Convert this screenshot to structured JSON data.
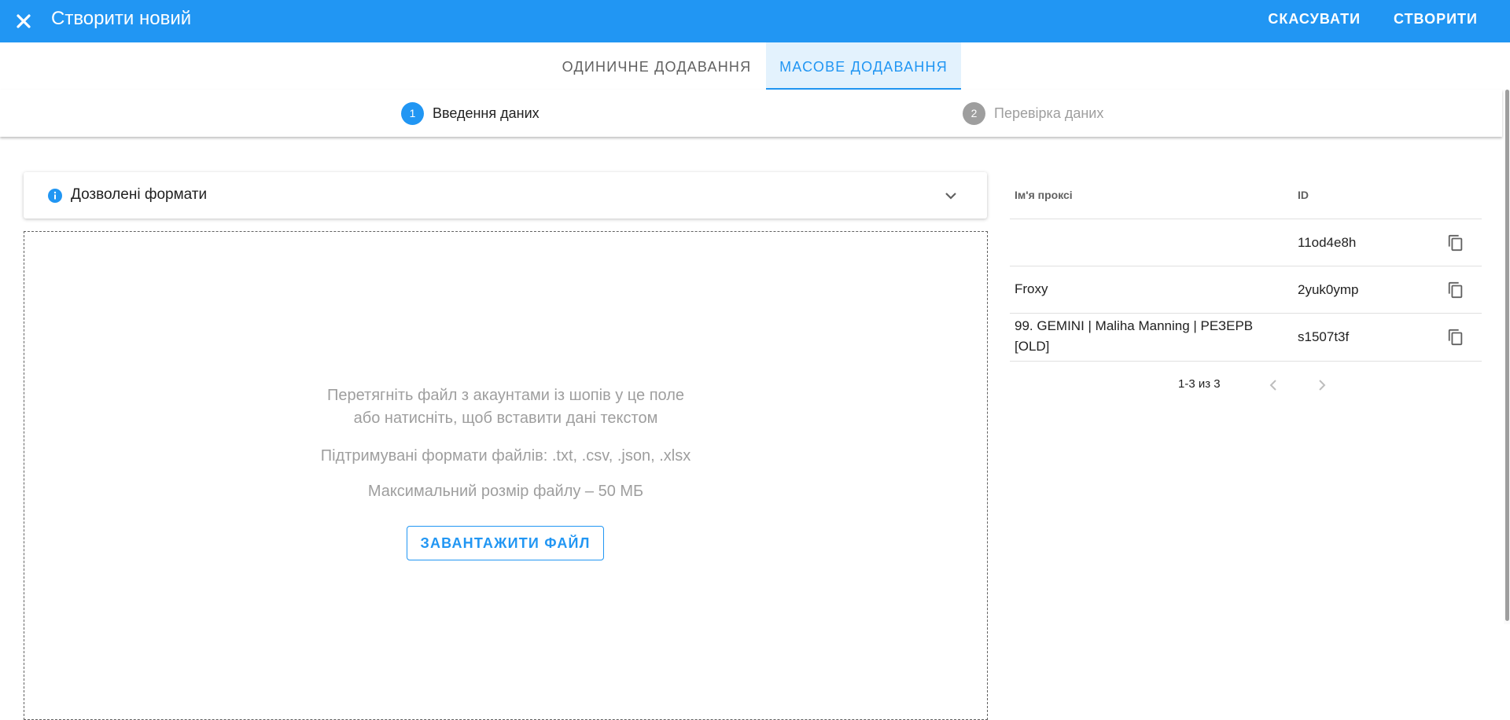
{
  "header": {
    "title": "Створити новий",
    "cancel_label": "СКАСУВАТИ",
    "create_label": "СТВОРИТИ"
  },
  "tabs": [
    {
      "label": "ОДИНИЧНЕ ДОДАВАННЯ",
      "active": false
    },
    {
      "label": "МАСОВЕ ДОДАВАННЯ",
      "active": true
    }
  ],
  "stepper": [
    {
      "number": "1",
      "label": "Введення даних",
      "active": true
    },
    {
      "number": "2",
      "label": "Перевірка даних",
      "active": false
    }
  ],
  "formats_panel": {
    "title": "Дозволені формати",
    "icon": "info-icon"
  },
  "dropzone": {
    "line1": "Перетягніть файл з акаунтами із шопів у це поле",
    "line2": "або натисніть, щоб вставити дані текстом",
    "supported": "Підтримувані формати файлів: .txt, .csv, .json, .xlsx",
    "max_size": "Максимальний розмір файлу – 50 МБ",
    "upload_label": "ЗАВАНТАЖИТИ ФАЙЛ"
  },
  "proxy_table": {
    "columns": [
      "Ім'я проксі",
      "ID"
    ],
    "rows": [
      {
        "name": "",
        "id": "11od4e8h"
      },
      {
        "name": "Froxy",
        "id": "2yuk0ymp"
      },
      {
        "name": "99. GEMINI | Maliha Manning | РЕЗЕРВ [OLD]",
        "id": "s1507t3f"
      }
    ],
    "pagination": "1-3 из 3"
  },
  "colors": {
    "accent": "#2196f3",
    "tab_active_bg": "#e3f2fd",
    "muted": "#9e9e9e"
  }
}
